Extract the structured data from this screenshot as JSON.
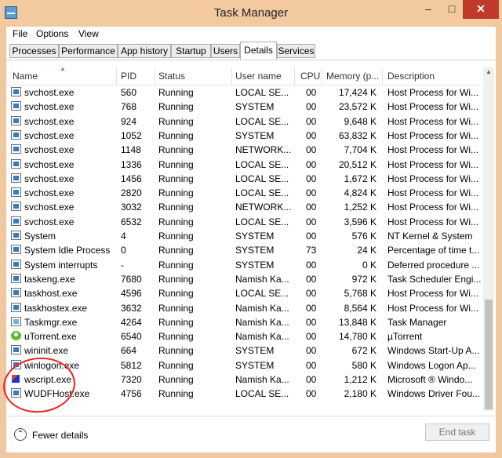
{
  "window": {
    "title": "Task Manager"
  },
  "menu": [
    "File",
    "Options",
    "View"
  ],
  "tabs": [
    {
      "label": "Processes"
    },
    {
      "label": "Performance"
    },
    {
      "label": "App history"
    },
    {
      "label": "Startup"
    },
    {
      "label": "Users"
    },
    {
      "label": "Details",
      "active": true
    },
    {
      "label": "Services"
    }
  ],
  "columns": {
    "name": "Name",
    "pid": "PID",
    "status": "Status",
    "user": "User name",
    "cpu": "CPU",
    "memory": "Memory (p...",
    "desc": "Description"
  },
  "rows": [
    {
      "name": "svchost.exe",
      "pid": "560",
      "status": "Running",
      "user": "LOCAL SE...",
      "cpu": "00",
      "memory": "17,424 K",
      "desc": "Host Process for Wi...",
      "icon": "window-icon"
    },
    {
      "name": "svchost.exe",
      "pid": "768",
      "status": "Running",
      "user": "SYSTEM",
      "cpu": "00",
      "memory": "23,572 K",
      "desc": "Host Process for Wi...",
      "icon": "window-icon"
    },
    {
      "name": "svchost.exe",
      "pid": "924",
      "status": "Running",
      "user": "LOCAL SE...",
      "cpu": "00",
      "memory": "9,648 K",
      "desc": "Host Process for Wi...",
      "icon": "window-icon"
    },
    {
      "name": "svchost.exe",
      "pid": "1052",
      "status": "Running",
      "user": "SYSTEM",
      "cpu": "00",
      "memory": "63,832 K",
      "desc": "Host Process for Wi...",
      "icon": "window-icon"
    },
    {
      "name": "svchost.exe",
      "pid": "1148",
      "status": "Running",
      "user": "NETWORK...",
      "cpu": "00",
      "memory": "7,704 K",
      "desc": "Host Process for Wi...",
      "icon": "window-icon"
    },
    {
      "name": "svchost.exe",
      "pid": "1336",
      "status": "Running",
      "user": "LOCAL SE...",
      "cpu": "00",
      "memory": "20,512 K",
      "desc": "Host Process for Wi...",
      "icon": "window-icon"
    },
    {
      "name": "svchost.exe",
      "pid": "1456",
      "status": "Running",
      "user": "LOCAL SE...",
      "cpu": "00",
      "memory": "1,672 K",
      "desc": "Host Process for Wi...",
      "icon": "window-icon"
    },
    {
      "name": "svchost.exe",
      "pid": "2820",
      "status": "Running",
      "user": "LOCAL SE...",
      "cpu": "00",
      "memory": "4,824 K",
      "desc": "Host Process for Wi...",
      "icon": "window-icon"
    },
    {
      "name": "svchost.exe",
      "pid": "3032",
      "status": "Running",
      "user": "NETWORK...",
      "cpu": "00",
      "memory": "1,252 K",
      "desc": "Host Process for Wi...",
      "icon": "window-icon"
    },
    {
      "name": "svchost.exe",
      "pid": "6532",
      "status": "Running",
      "user": "LOCAL SE...",
      "cpu": "00",
      "memory": "3,596 K",
      "desc": "Host Process for Wi...",
      "icon": "window-icon"
    },
    {
      "name": "System",
      "pid": "4",
      "status": "Running",
      "user": "SYSTEM",
      "cpu": "00",
      "memory": "576 K",
      "desc": "NT Kernel & System",
      "icon": "window-icon"
    },
    {
      "name": "System Idle Process",
      "pid": "0",
      "status": "Running",
      "user": "SYSTEM",
      "cpu": "73",
      "memory": "24 K",
      "desc": "Percentage of time t...",
      "icon": "window-icon"
    },
    {
      "name": "System interrupts",
      "pid": "-",
      "status": "Running",
      "user": "SYSTEM",
      "cpu": "00",
      "memory": "0 K",
      "desc": "Deferred procedure ...",
      "icon": "window-icon"
    },
    {
      "name": "taskeng.exe",
      "pid": "7680",
      "status": "Running",
      "user": "Namish Ka...",
      "cpu": "00",
      "memory": "972 K",
      "desc": "Task Scheduler Engi...",
      "icon": "window-icon"
    },
    {
      "name": "taskhost.exe",
      "pid": "4596",
      "status": "Running",
      "user": "LOCAL SE...",
      "cpu": "00",
      "memory": "5,768 K",
      "desc": "Host Process for Wi...",
      "icon": "window-icon"
    },
    {
      "name": "taskhostex.exe",
      "pid": "3632",
      "status": "Running",
      "user": "Namish Ka...",
      "cpu": "00",
      "memory": "8,564 K",
      "desc": "Host Process for Wi...",
      "icon": "window-icon"
    },
    {
      "name": "Taskmgr.exe",
      "pid": "4264",
      "status": "Running",
      "user": "Namish Ka...",
      "cpu": "00",
      "memory": "13,848 K",
      "desc": "Task Manager",
      "icon": "task-manager-icon"
    },
    {
      "name": "uTorrent.exe",
      "pid": "6540",
      "status": "Running",
      "user": "Namish Ka...",
      "cpu": "00",
      "memory": "14,780 K",
      "desc": "µTorrent",
      "icon": "utorrent-icon"
    },
    {
      "name": "wininit.exe",
      "pid": "664",
      "status": "Running",
      "user": "SYSTEM",
      "cpu": "00",
      "memory": "672 K",
      "desc": "Windows Start-Up A...",
      "icon": "window-icon"
    },
    {
      "name": "winlogon.exe",
      "pid": "5812",
      "status": "Running",
      "user": "SYSTEM",
      "cpu": "00",
      "memory": "580 K",
      "desc": "Windows Logon Ap...",
      "icon": "window-icon"
    },
    {
      "name": "wscript.exe",
      "pid": "7320",
      "status": "Running",
      "user": "Namish Ka...",
      "cpu": "00",
      "memory": "1,212 K",
      "desc": "Microsoft ® Windo...",
      "icon": "script-icon"
    },
    {
      "name": "WUDFHost.exe",
      "pid": "4756",
      "status": "Running",
      "user": "LOCAL SE...",
      "cpu": "00",
      "memory": "2,180 K",
      "desc": "Windows Driver Fou...",
      "icon": "window-icon"
    }
  ],
  "footer": {
    "fewer_details": "Fewer details",
    "end_task": "End task"
  },
  "colors": {
    "title_bar": "#f3c9a0",
    "close_button": "#c0392b",
    "annotation": "#e22222"
  }
}
